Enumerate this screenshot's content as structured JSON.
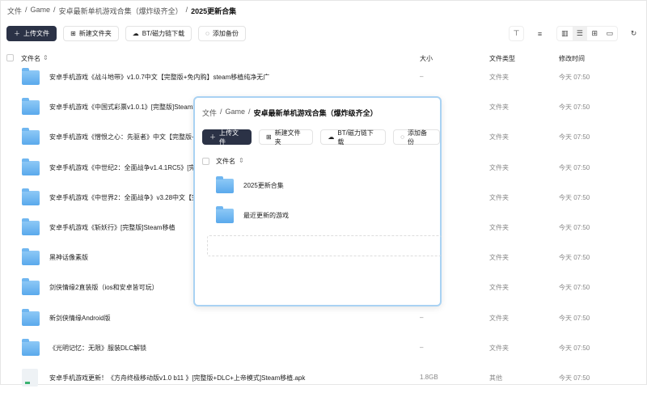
{
  "breadcrumb": [
    "文件",
    "Game",
    "安卓最新单机游戏合集（爆炸级齐全）",
    "2025更新合集"
  ],
  "toolbar": {
    "upload": "上传文件",
    "new_folder": "新建文件夹",
    "bt": "BT/磁力链下载",
    "backup": "添加备份"
  },
  "icons": {
    "filter": "filter-icon",
    "sort": "sort-icon",
    "views": [
      "columns-view-icon",
      "list-view-icon",
      "grid-view-icon",
      "single-view-icon"
    ],
    "refresh": "refresh-icon"
  },
  "columns": {
    "name": "文件名",
    "size": "大小",
    "type": "文件类型",
    "modified": "修改时间"
  },
  "files": [
    {
      "name": "安卓手机游戏《战斗地带》v1.0.7中文【完整版+免内购】steam移植纯净无广",
      "size": "–",
      "type": "文件夹",
      "modified": "今天 07:50",
      "kind": "folder"
    },
    {
      "name": "安卓手机游戏《中国式彩票v1.0.1》[完整版]Steam移植",
      "size": "–",
      "type": "文件夹",
      "modified": "今天 07:50",
      "kind": "folder"
    },
    {
      "name": "安卓手机游戏《憎恨之心：先驱者》中文【完整版+",
      "size": "–",
      "type": "文件夹",
      "modified": "今天 07:50",
      "kind": "folder"
    },
    {
      "name": "安卓手机游戏《中世纪2：全面战争v1.4.1RC5》[完",
      "size": "–",
      "type": "文件夹",
      "modified": "今天 07:50",
      "kind": "folder"
    },
    {
      "name": "安卓手机游戏《中世界2：全面战争》v3.28中文【完",
      "size": "–",
      "type": "文件夹",
      "modified": "今天 07:50",
      "kind": "folder"
    },
    {
      "name": "安卓手机游戏《斩妖行》[完整版]Steam移植",
      "size": "–",
      "type": "文件夹",
      "modified": "今天 07:50",
      "kind": "folder"
    },
    {
      "name": "黑神话像素版",
      "size": "–",
      "type": "文件夹",
      "modified": "今天 07:50",
      "kind": "folder"
    },
    {
      "name": "剑侠情缘2直装版（ios和安卓皆可玩）",
      "size": "–",
      "type": "文件夹",
      "modified": "今天 07:50",
      "kind": "folder"
    },
    {
      "name": "新剑侠情缘Android版",
      "size": "–",
      "type": "文件夹",
      "modified": "今天 07:50",
      "kind": "folder"
    },
    {
      "name": "《光明记忆：无限》服装DLC解锁",
      "size": "–",
      "type": "文件夹",
      "modified": "今天 07:50",
      "kind": "folder"
    },
    {
      "name": "安卓手机游戏更新！《方舟终极移动版v1.0 b11 》[完整版+DLC+上帝模式]Steam移植.apk",
      "size": "1.8GB",
      "type": "其他",
      "modified": "今天 07:50",
      "kind": "apk"
    }
  ],
  "dialog": {
    "breadcrumb": [
      "文件",
      "Game",
      "安卓最新单机游戏合集（爆炸级齐全）"
    ],
    "toolbar": {
      "upload": "上传文件",
      "new_folder": "新建文件夹",
      "bt": "BT/磁力链下载",
      "backup": "添加备份"
    },
    "column_name": "文件名",
    "folders": [
      "2025更新合集",
      "最近更新的游戏"
    ]
  }
}
